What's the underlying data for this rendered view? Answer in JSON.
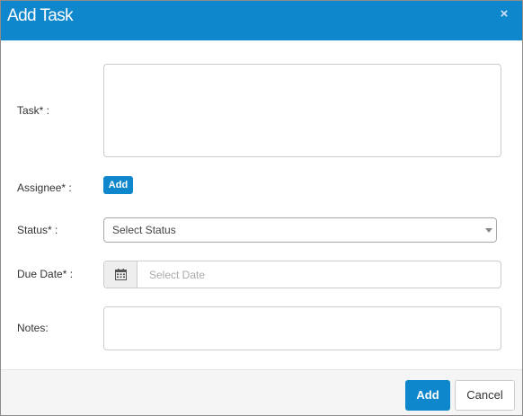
{
  "dialog": {
    "title": "Add Task",
    "close_icon": "close-icon"
  },
  "form": {
    "task_label": "Task* :",
    "assignee_label": "Assignee* :",
    "assignee_add_label": "Add",
    "status_label": "Status* :",
    "status_value": "Select Status",
    "due_date_label": "Due Date* :",
    "due_date_placeholder": "Select Date",
    "calendar_icon": "calendar-icon",
    "notes_label": "Notes:"
  },
  "footer": {
    "add_label": "Add",
    "cancel_label": "Cancel"
  },
  "colors": {
    "header_bg": "#0f87cc",
    "primary_button": "#0f87cc"
  }
}
